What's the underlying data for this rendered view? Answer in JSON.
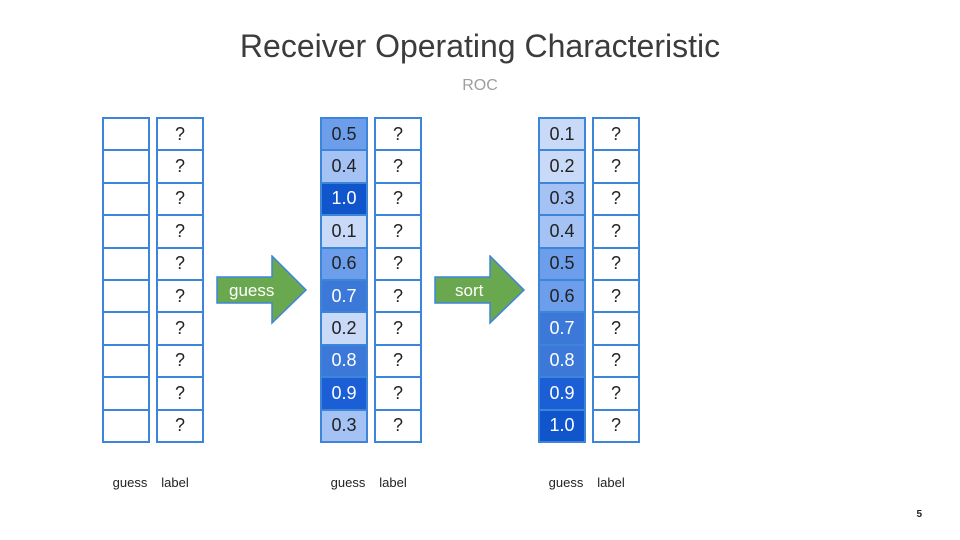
{
  "title": "Receiver Operating Characteristic",
  "subtitle": "ROC",
  "page_number": "5",
  "arrows": {
    "first": "guess",
    "second": "sort"
  },
  "captions": {
    "guess": "guess",
    "label": "label"
  },
  "label_placeholder": "?",
  "unsorted_scores": [
    "0.5",
    "0.4",
    "1.0",
    "0.1",
    "0.6",
    "0.7",
    "0.2",
    "0.8",
    "0.9",
    "0.3"
  ],
  "sorted_scores": [
    "0.1",
    "0.2",
    "0.3",
    "0.4",
    "0.5",
    "0.6",
    "0.7",
    "0.8",
    "0.9",
    "1.0"
  ],
  "colors": {
    "border": "#3d85d8",
    "arrow_fill": "#6aa84f",
    "score_0.1": "#c9daf8",
    "score_0.2": "#c9daf8",
    "score_0.3": "#a4c2f4",
    "score_0.4": "#a4c2f4",
    "score_0.5": "#6d9eeb",
    "score_0.6": "#6d9eeb",
    "score_0.7": "#3c78d8",
    "score_0.8": "#3c78d8",
    "score_0.9": "#1c5ed6",
    "score_1.0": "#1155cc"
  }
}
